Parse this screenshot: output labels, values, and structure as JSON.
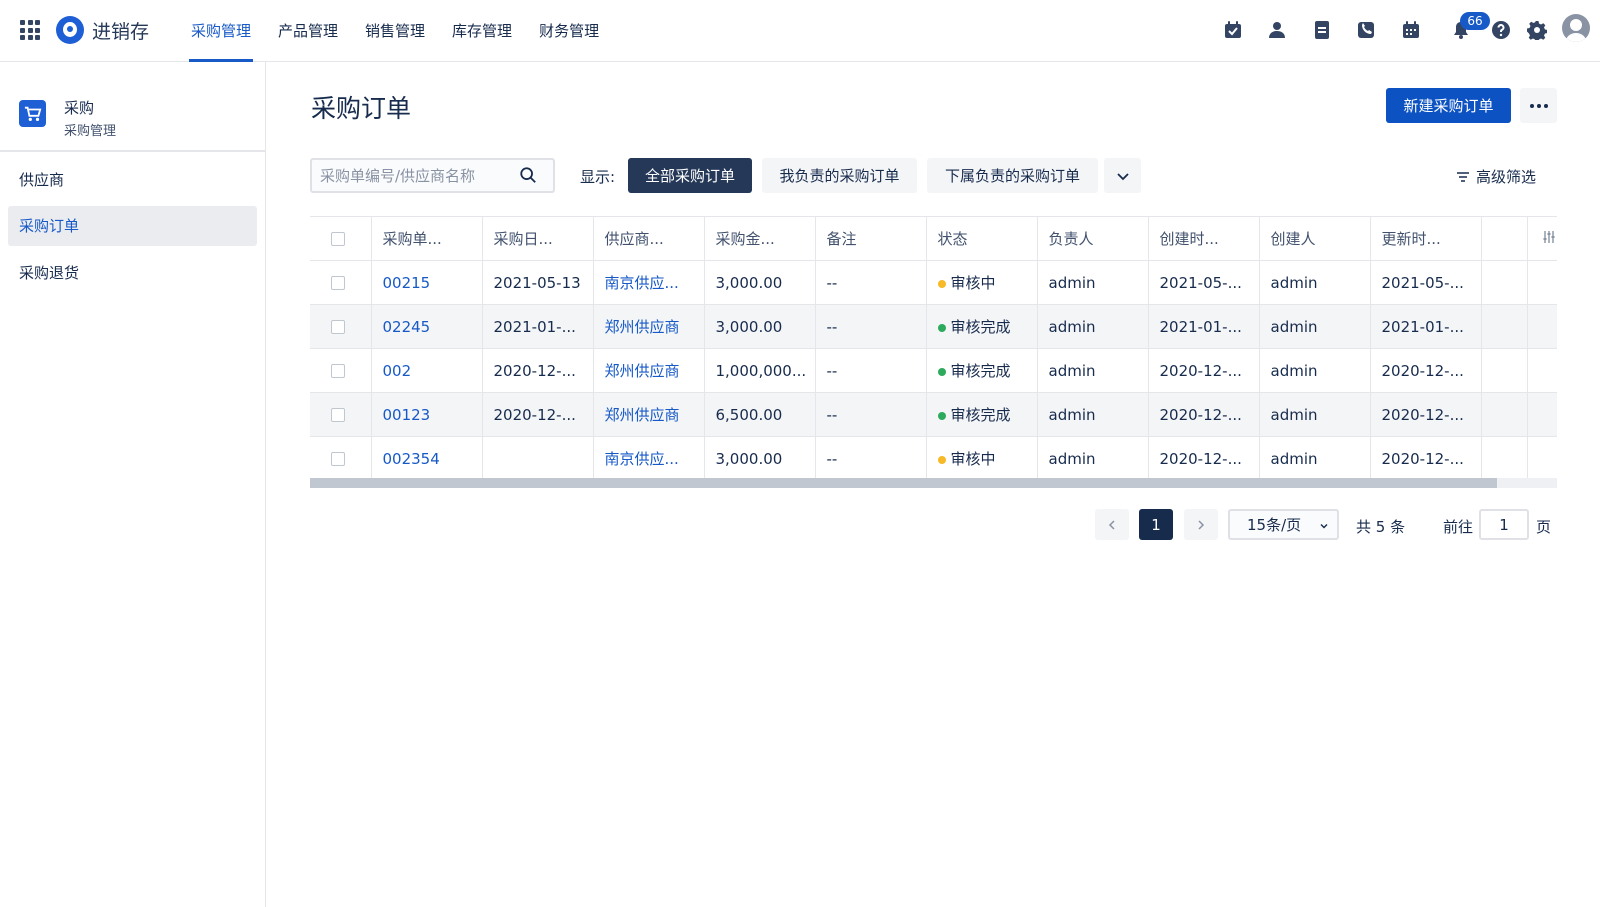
{
  "header": {
    "brand": "进销存",
    "nav": [
      "采购管理",
      "产品管理",
      "销售管理",
      "库存管理",
      "财务管理"
    ],
    "active_nav": 0,
    "notification_count": "66",
    "icons": [
      "calendar-check-icon",
      "contact-icon",
      "document-icon",
      "phone-icon",
      "calendar-icon",
      "bell-icon",
      "help-icon",
      "gear-icon",
      "user-avatar-icon"
    ]
  },
  "sidebar": {
    "title": "采购",
    "subtitle": "采购管理",
    "items": [
      "供应商",
      "采购订单",
      "采购退货"
    ],
    "active_item": 1
  },
  "main": {
    "title": "采购订单",
    "new_button": "新建采购订单",
    "search_placeholder": "采购单编号/供应商名称",
    "filter_label": "显示:",
    "filters": [
      "全部采购订单",
      "我负责的采购订单",
      "下属负责的采购订单"
    ],
    "active_filter": 0,
    "advanced_filter": "高级筛选"
  },
  "table": {
    "columns": [
      "采购单...",
      "采购日...",
      "供应商...",
      "采购金...",
      "备注",
      "状态",
      "负责人",
      "创建时...",
      "创建人",
      "更新时..."
    ],
    "rows": [
      {
        "id": "00215",
        "date": "2021-05-13",
        "supplier": "南京供应...",
        "amount": "3,000.00",
        "note": "--",
        "status": "审核中",
        "status_color": "#f7b928",
        "owner": "admin",
        "created": "2021-05-...",
        "creator": "admin",
        "updated": "2021-05-..."
      },
      {
        "id": "02245",
        "date": "2021-01-...",
        "supplier": "郑州供应商",
        "amount": "3,000.00",
        "note": "--",
        "status": "审核完成",
        "status_color": "#2eaa5c",
        "owner": "admin",
        "created": "2021-01-...",
        "creator": "admin",
        "updated": "2021-01-..."
      },
      {
        "id": "002",
        "date": "2020-12-...",
        "supplier": "郑州供应商",
        "amount": "1,000,000...",
        "note": "--",
        "status": "审核完成",
        "status_color": "#2eaa5c",
        "owner": "admin",
        "created": "2020-12-...",
        "creator": "admin",
        "updated": "2020-12-..."
      },
      {
        "id": "00123",
        "date": "2020-12-...",
        "supplier": "郑州供应商",
        "amount": "6,500.00",
        "note": "--",
        "status": "审核完成",
        "status_color": "#2eaa5c",
        "owner": "admin",
        "created": "2020-12-...",
        "creator": "admin",
        "updated": "2020-12-..."
      },
      {
        "id": "002354",
        "date": "",
        "supplier": "南京供应...",
        "amount": "3,000.00",
        "note": "--",
        "status": "审核中",
        "status_color": "#f7b928",
        "owner": "admin",
        "created": "2020-12-...",
        "creator": "admin",
        "updated": "2020-12-..."
      }
    ]
  },
  "pagination": {
    "current": "1",
    "page_size": "15条/页",
    "total": "共 5 条",
    "goto_label": "前往",
    "goto_value": "1",
    "page_suffix": "页"
  }
}
